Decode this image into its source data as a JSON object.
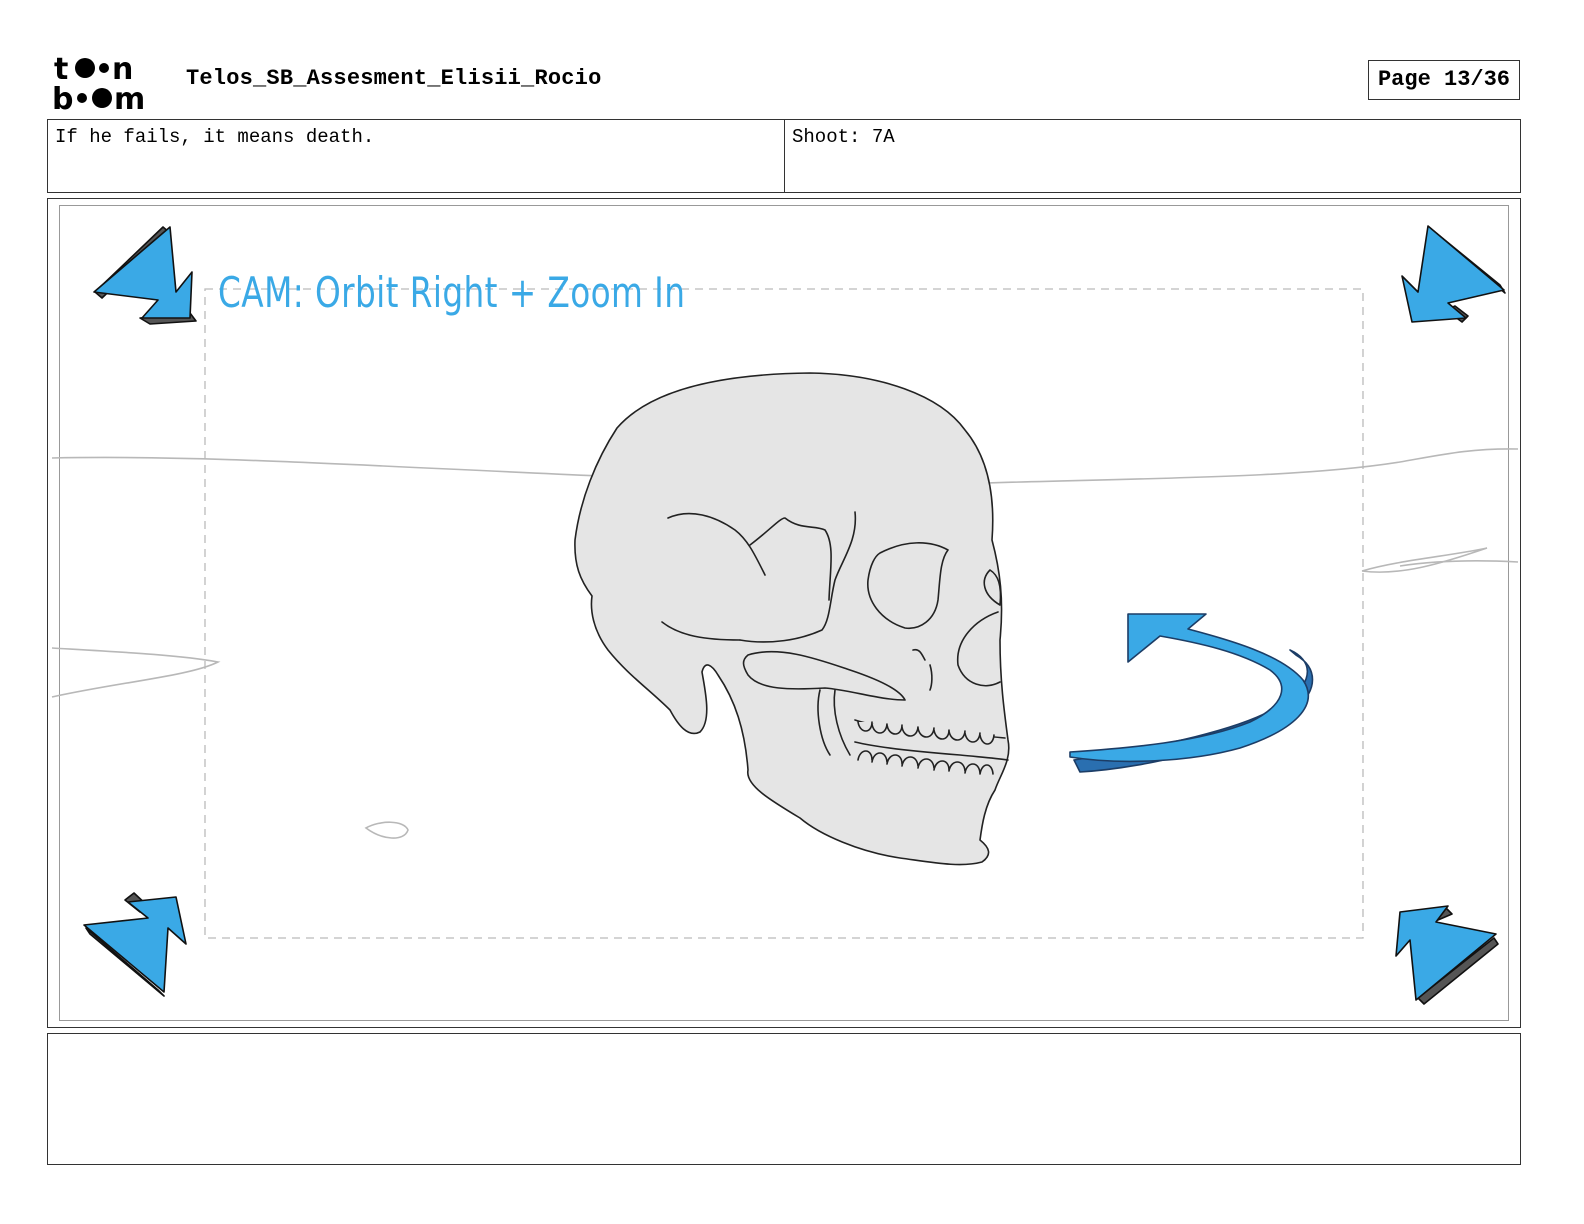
{
  "header": {
    "logo_alt": "toon boom",
    "project_title": "Telos_SB_Assesment_Elisii_Rocio",
    "page_label": "Page 13/36"
  },
  "panel_info": {
    "dialogue": "If he fails, it means death.",
    "shot": "Shoot: 7A"
  },
  "panel": {
    "camera_note": "CAM: Orbit Right + Zoom In",
    "arrow_color": "#3aa9e6"
  },
  "notes": {
    "text": ""
  }
}
